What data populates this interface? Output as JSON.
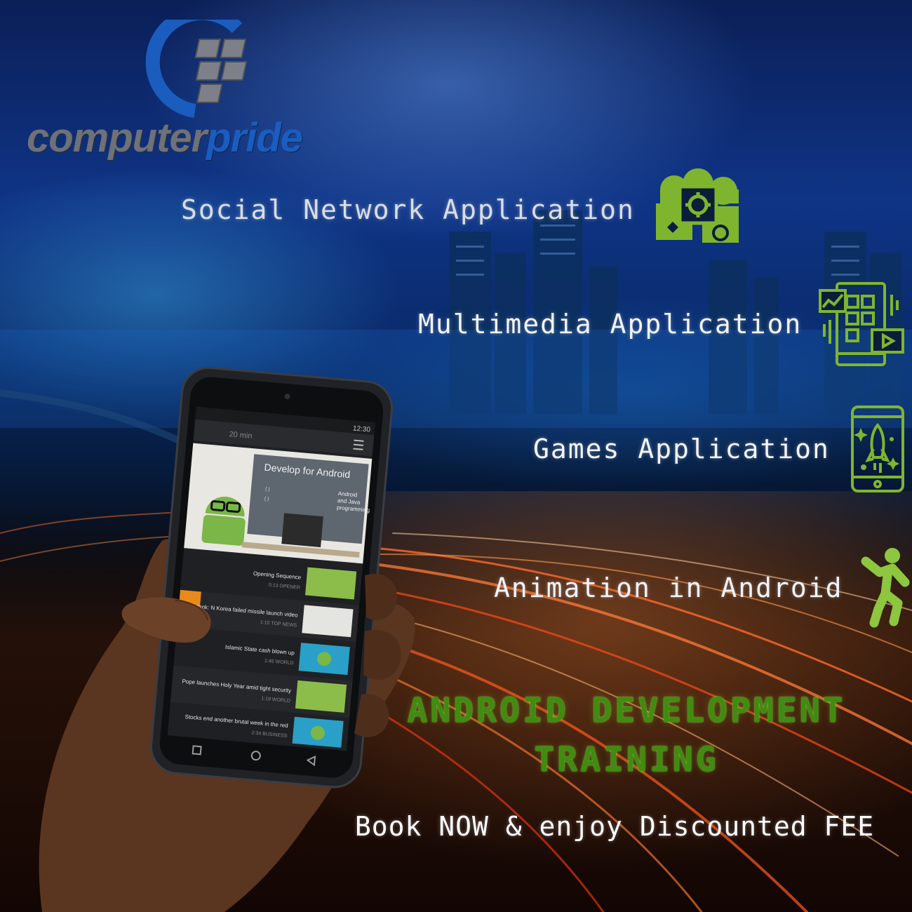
{
  "brand": {
    "name_part1": "computer",
    "name_part2": "pride",
    "logo_icon": "grid-squares-arc-logo"
  },
  "features": [
    {
      "label": "Social Network Application",
      "icon": "cloud-gear-puzzle-icon"
    },
    {
      "label": "Multimedia Application",
      "icon": "mobile-apps-icon"
    },
    {
      "label": "Games Application",
      "icon": "phone-rocket-icon"
    },
    {
      "label": "Animation in Android",
      "icon": "running-person-icon"
    }
  ],
  "headline": {
    "line1": "ANDROID DEVELOPMENT",
    "line2": "TRAINING"
  },
  "cta": "Book NOW & enjoy Discounted FEE",
  "phone": {
    "status_time": "12:30",
    "top_left": "20 min",
    "banner_title": "Develop for Android",
    "banner_code": [
      "{ }",
      "{ }"
    ],
    "banner_side": [
      "Android",
      "and Java",
      "programming"
    ],
    "items": [
      {
        "title": "Opening Sequence",
        "meta": "0:13 OPENER"
      },
      {
        "title": "Think tank: N Korea failed missile launch video",
        "meta": "1:10 TOP NEWS"
      },
      {
        "title": "Islamic State cash blown up",
        "meta": "1:45 WORLD"
      },
      {
        "title": "Pope launches Holy Year amid tight security",
        "meta": "1:19 WORLD"
      },
      {
        "title": "Stocks end another brutal week in the red",
        "meta": "2:34 BUSINESS"
      }
    ]
  },
  "colors": {
    "accent_green": "#8dc63f",
    "headline_green": "#3f8c0f",
    "logo_blue": "#1b5dbf",
    "logo_gray": "#6e7178"
  }
}
